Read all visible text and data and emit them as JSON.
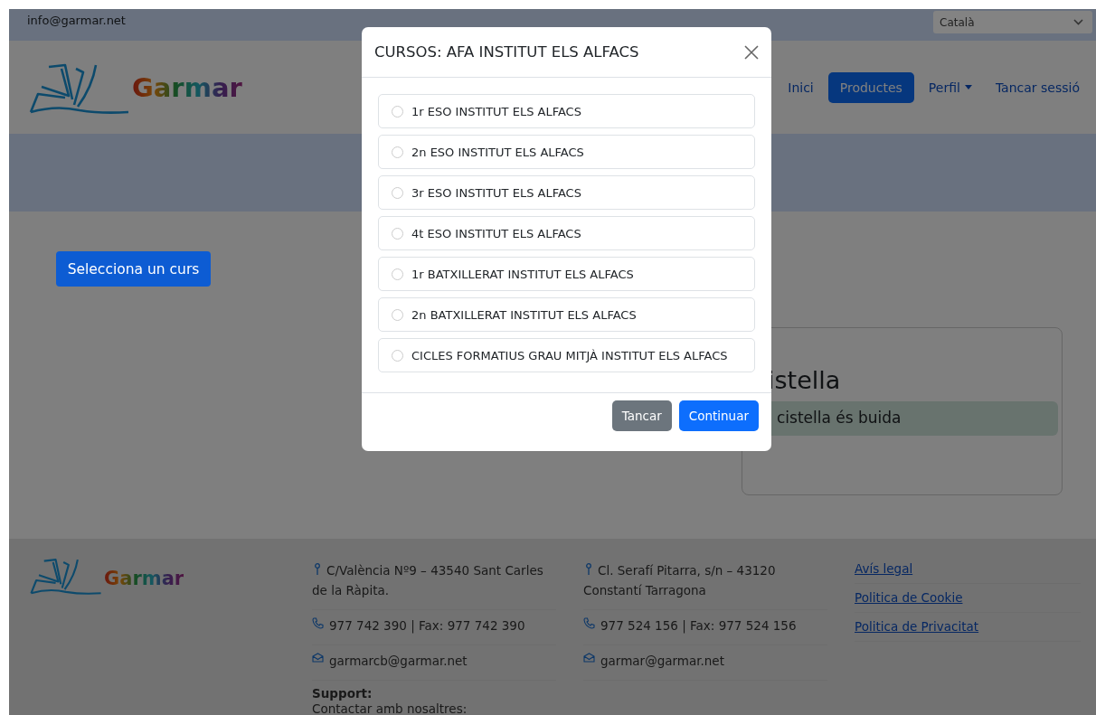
{
  "top_bar": {
    "email": "info@garmar.net",
    "language": "Català"
  },
  "header": {
    "logo": "Garmar",
    "nav": [
      {
        "label": "Inici",
        "selected": false,
        "kind": "link"
      },
      {
        "label": "Productes",
        "selected": true,
        "kind": "link"
      },
      {
        "label": "Perfil",
        "selected": false,
        "kind": "dropdown"
      },
      {
        "label": "Tancar sessió",
        "selected": false,
        "kind": "link"
      }
    ]
  },
  "main": {
    "select_button": "Selecciona un curs",
    "cart": {
      "title": "istella",
      "message": "cistella és buida"
    }
  },
  "footer": {
    "logo": "Garmar",
    "locations": [
      {
        "address": "C/València Nº9 – 43540 Sant Carles de la Ràpita.",
        "phone": "977 742 390 | Fax: 977 742 390",
        "email": "garmarcb@garmar.net"
      },
      {
        "address": "Cl. Serafí Pitarra, s/n – 43120 Constantí Tarragona",
        "phone": "977 524 156 | Fax: 977 524 156",
        "email": "garmar@garmar.net"
      }
    ],
    "support": {
      "title": "Support:",
      "text": "Contactar amb nosaltres:"
    },
    "links": [
      "Avís legal",
      "Politica de Cookie",
      "Politica de Privacitat"
    ]
  },
  "modal": {
    "title": "CURSOS: AFA INSTITUT ELS ALFACS",
    "options": [
      {
        "label": "1r ESO INSTITUT ELS ALFACS",
        "selected": false
      },
      {
        "label": "2n ESO INSTITUT ELS ALFACS",
        "selected": false
      },
      {
        "label": "3r ESO INSTITUT ELS ALFACS",
        "selected": false
      },
      {
        "label": "4t ESO INSTITUT ELS ALFACS",
        "selected": false
      },
      {
        "label": "1r BATXILLERAT INSTITUT ELS ALFACS",
        "selected": false
      },
      {
        "label": "2n BATXILLERAT INSTITUT ELS ALFACS",
        "selected": false
      },
      {
        "label": "CICLES FORMATIUS GRAU MITJÀ INSTITUT ELS ALFACS",
        "selected": false
      }
    ],
    "buttons": [
      {
        "label": "Tancar",
        "kind": "secondary"
      },
      {
        "label": "Continuar",
        "kind": "primary"
      }
    ]
  }
}
